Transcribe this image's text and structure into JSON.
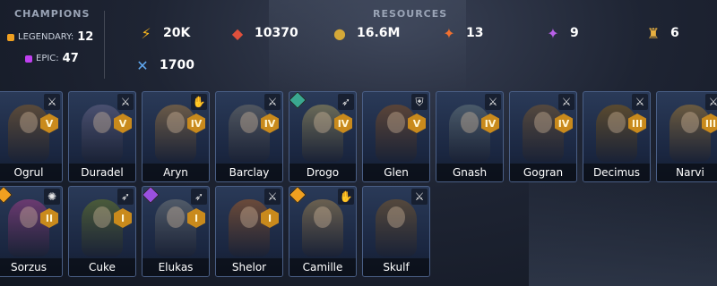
{
  "champions": {
    "heading": "CHAMPIONS",
    "legendary_label": "LEGENDARY:",
    "legendary_count": "12",
    "epic_label": "EPIC:",
    "epic_count": "47",
    "legendary_color": "#f0a020",
    "epic_color": "#c040f0"
  },
  "resources": {
    "heading": "RESOURCES",
    "items": [
      {
        "icon": "energy-bolt-icon",
        "glyph": "⚡",
        "color": "#f5b41e",
        "value": "20K"
      },
      {
        "icon": "ruby-gems-icon",
        "glyph": "◆",
        "color": "#e0503c",
        "value": "10370"
      },
      {
        "icon": "silver-coin-icon",
        "glyph": "●",
        "color": "#d4a838",
        "value": "16.6M"
      },
      {
        "icon": "red-crystal-icon",
        "glyph": "✦",
        "color": "#f07030",
        "value": "13"
      },
      {
        "icon": "purple-crystal-icon",
        "glyph": "✦",
        "color": "#b860e8",
        "value": "9"
      },
      {
        "icon": "gold-shards-icon",
        "glyph": "♜",
        "color": "#e8b040",
        "value": "6"
      },
      {
        "icon": "arena-tokens-icon",
        "glyph": "✕",
        "color": "#60a8f0",
        "value": "1700"
      }
    ]
  },
  "cards": [
    {
      "name": "Ogrul",
      "rank": "V",
      "role": "⚔",
      "rarity": "",
      "tone": "#5a4a3a"
    },
    {
      "name": "Duradel",
      "rank": "V",
      "role": "⚔",
      "rarity": "",
      "tone": "#4a5070"
    },
    {
      "name": "Aryn",
      "rank": "IV",
      "role": "✋",
      "rarity": "",
      "tone": "#6a5a48"
    },
    {
      "name": "Barclay",
      "rank": "IV",
      "role": "⚔",
      "rarity": "",
      "tone": "#505660"
    },
    {
      "name": "Drogo",
      "rank": "IV",
      "role": "➶",
      "rarity": "#3aa890",
      "tone": "#6a6a58"
    },
    {
      "name": "Glen",
      "rank": "V",
      "role": "⛨",
      "rarity": "",
      "tone": "#5a4438"
    },
    {
      "name": "Gnash",
      "rank": "IV",
      "role": "⚔",
      "rarity": "",
      "tone": "#4a5a6a"
    },
    {
      "name": "Gogran",
      "rank": "IV",
      "role": "⚔",
      "rarity": "",
      "tone": "#54483e"
    },
    {
      "name": "Decimus",
      "rank": "III",
      "role": "⚔",
      "rarity": "",
      "tone": "#5a4a30"
    },
    {
      "name": "Narvi",
      "rank": "III",
      "role": "⚔",
      "rarity": "",
      "tone": "#6a5a40"
    },
    {
      "name": "Sorzus",
      "rank": "II",
      "role": "✺",
      "rarity": "#f0a020",
      "tone": "#6a3a70"
    },
    {
      "name": "Cuke",
      "rank": "I",
      "role": "➶",
      "rarity": "",
      "tone": "#4a5a3a"
    },
    {
      "name": "Elukas",
      "rank": "I",
      "role": "➶",
      "rarity": "#9a50e0",
      "tone": "#505a68"
    },
    {
      "name": "Shelor",
      "rank": "I",
      "role": "⚔",
      "rarity": "",
      "tone": "#6a4a3a"
    },
    {
      "name": "Camille",
      "rank": "",
      "role": "✋",
      "rarity": "#f0a020",
      "tone": "#6a6050"
    },
    {
      "name": "Skulf",
      "rank": "",
      "role": "⚔",
      "rarity": "",
      "tone": "#54483c"
    }
  ]
}
